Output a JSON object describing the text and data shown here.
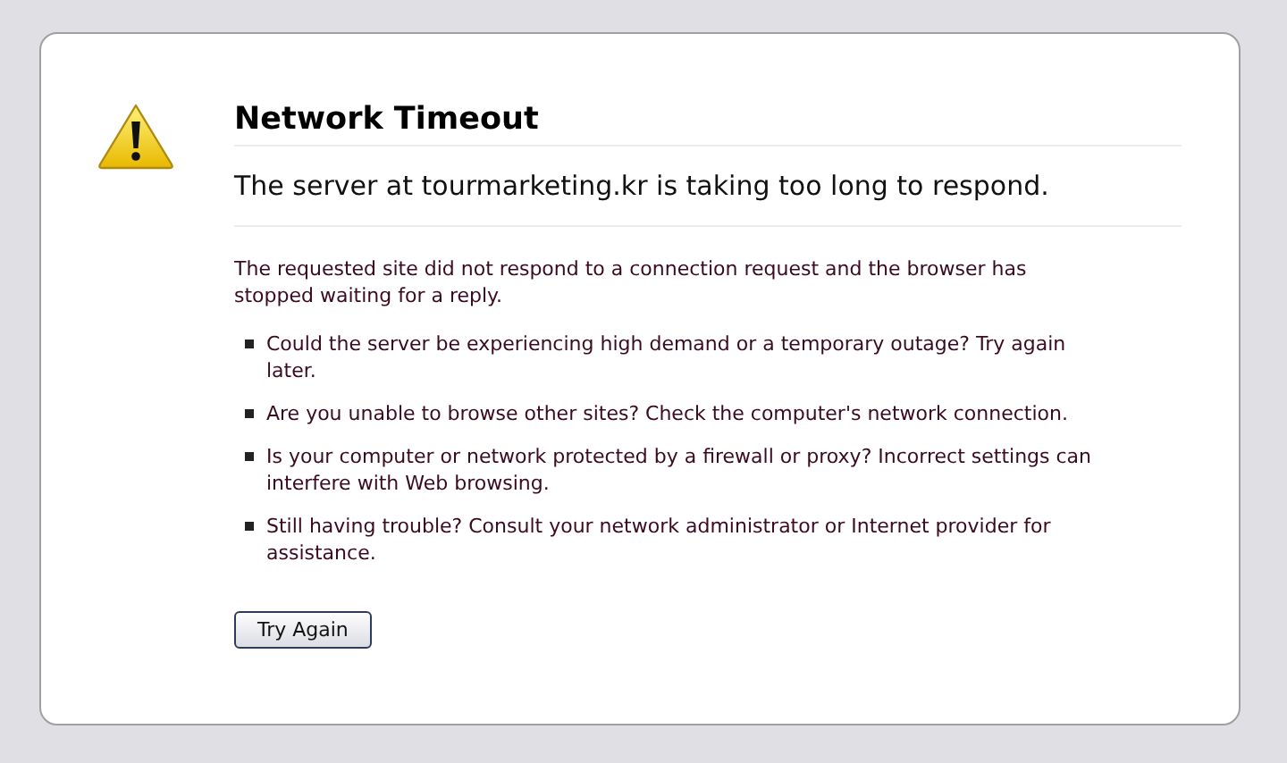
{
  "title": "Network Timeout",
  "subtitle": "The server at tourmarketing.kr is taking too long to respond.",
  "description": "The requested site did not respond to a connection request and the browser has stopped waiting for a reply.",
  "suggestions": [
    "Could the server be experiencing high demand or a temporary outage? Try again later.",
    "Are you unable to browse other sites? Check the computer's network connection.",
    "Is your computer or network protected by a firewall or proxy? Incorrect settings can interfere with Web browsing.",
    "Still having trouble? Consult your network administrator or Internet provider for assistance."
  ],
  "button": "Try Again"
}
